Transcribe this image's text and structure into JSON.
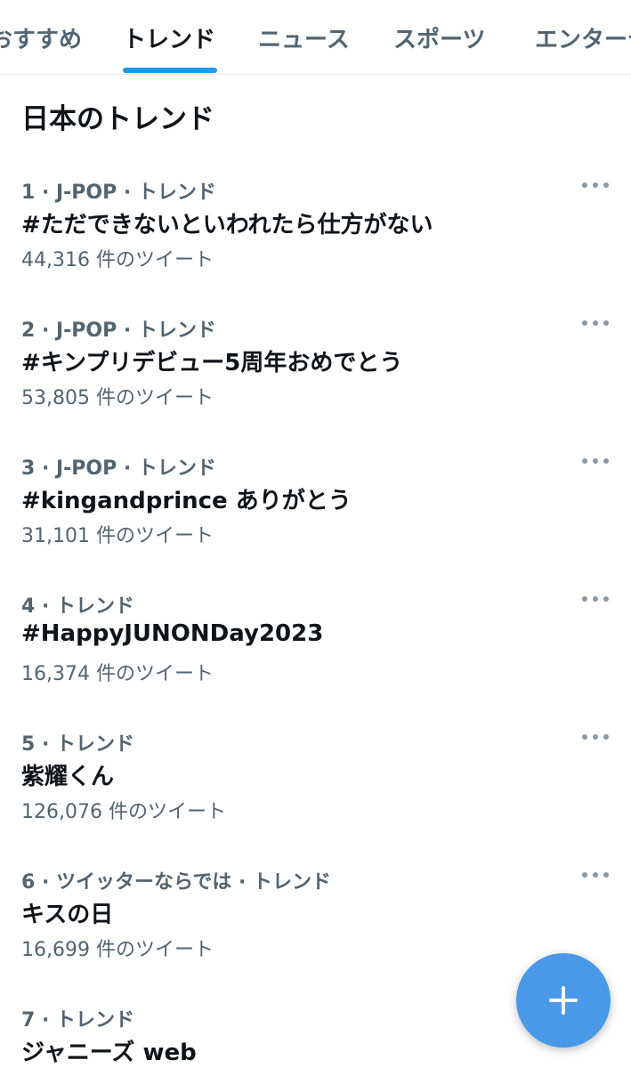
{
  "tabs": [
    {
      "label": "おすすめ"
    },
    {
      "label": "トレンド"
    },
    {
      "label": "ニュース"
    },
    {
      "label": "スポーツ"
    },
    {
      "label": "エンターテイメント"
    }
  ],
  "active_tab": "トレンド",
  "section_title": "日本のトレンド",
  "trends": [
    {
      "meta": "1 · J-POP · トレンド",
      "name": "#ただできないといわれたら仕方がない",
      "count": "44,316 件のツイート"
    },
    {
      "meta": "2 · J-POP · トレンド",
      "name": "#キンプリデビュー5周年おめでとう",
      "count": "53,805 件のツイート"
    },
    {
      "meta": "3 · J-POP · トレンド",
      "name": "#kingandprince ありがとう",
      "count": "31,101 件のツイート"
    },
    {
      "meta": "4 · トレンド",
      "name": "#HappyJUNONDay2023",
      "count": "16,374 件のツイート"
    },
    {
      "meta": "5 · トレンド",
      "name": "紫耀くん",
      "count": "126,076 件のツイート"
    },
    {
      "meta": "6 · ツイッターならでは · トレンド",
      "name": "キスの日",
      "count": "16,699 件のツイート"
    },
    {
      "meta": "7 · トレンド",
      "name": "ジャニーズ web",
      "count": ""
    }
  ],
  "icons": {
    "more": "more-horizontal-icon",
    "compose": "plus-icon"
  },
  "colors": {
    "accent": "#1d9bf0",
    "fab": "#4a99e9",
    "secondary_text": "#536471",
    "primary_text": "#0f1419"
  }
}
